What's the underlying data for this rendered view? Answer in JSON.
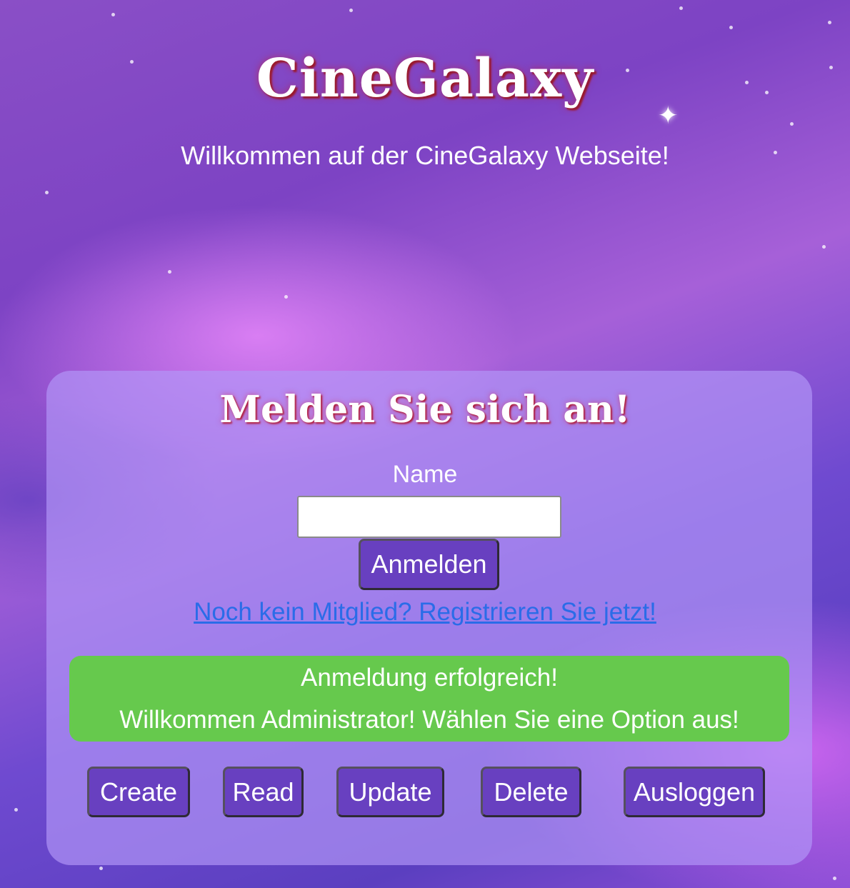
{
  "header": {
    "title": "CineGalaxy",
    "subtitle": "Willkommen auf der CineGalaxy Webseite!"
  },
  "login": {
    "heading": "Melden Sie sich an!",
    "name_label": "Name",
    "name_value": "",
    "submit_label": "Anmelden",
    "register_link": "Noch kein Mitglied? Registrieren Sie jetzt!"
  },
  "status": {
    "line1": "Anmeldung erfolgreich!",
    "line2": "Willkommen Administrator! Wählen Sie eine Option aus!"
  },
  "actions": {
    "create": "Create",
    "read": "Read",
    "update": "Update",
    "delete": "Delete",
    "logout": "Ausloggen"
  },
  "colors": {
    "panel": "#b296f8",
    "button": "#6840c0",
    "success": "#66c94d",
    "link": "#2a6ce8",
    "title_glow": "#9a1a2c"
  }
}
